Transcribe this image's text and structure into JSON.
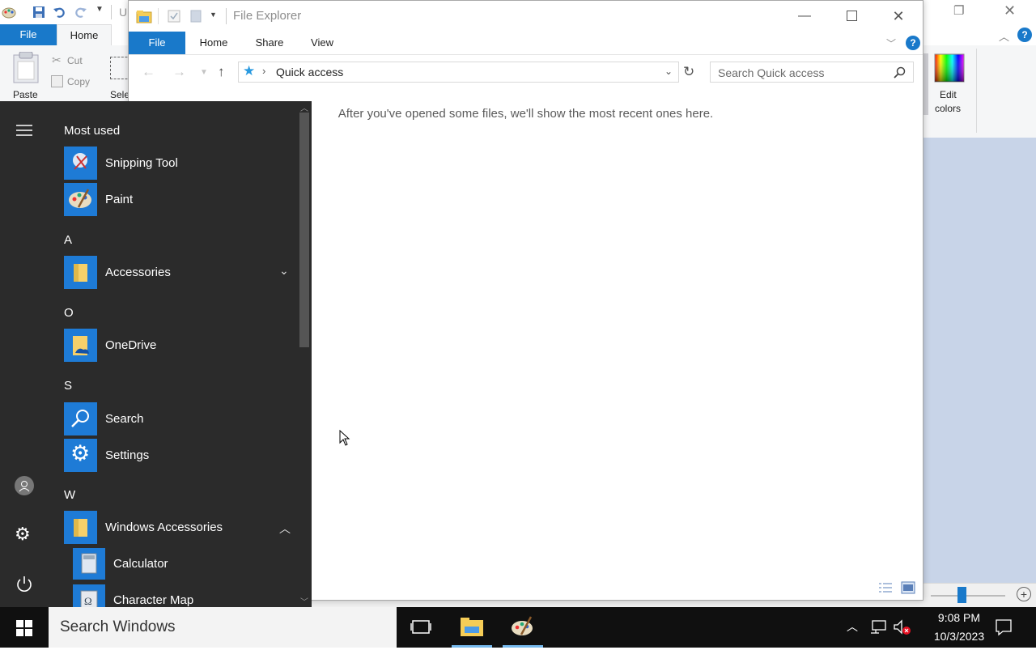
{
  "paint": {
    "title_partial": "U",
    "tab_file": "File",
    "tab_home": "Home",
    "paste": "Paste",
    "cut": "Cut",
    "copy": "Copy",
    "select_partial": "Sele",
    "edit_colors_line1": "Edit",
    "edit_colors_line2": "colors"
  },
  "explorer": {
    "title": "File Explorer",
    "tabs": [
      "File",
      "Home",
      "Share",
      "View"
    ],
    "address": "Quick access",
    "search_placeholder": "Search Quick access",
    "empty_message": "After you've opened some files, we'll show the most recent ones here."
  },
  "start_menu": {
    "most_used_header": "Most used",
    "most_used": [
      {
        "label": "Snipping Tool",
        "icon": "snipping-tool-icon"
      },
      {
        "label": "Paint",
        "icon": "paint-icon"
      }
    ],
    "sections": [
      {
        "letter": "A",
        "items": [
          {
            "label": "Accessories",
            "icon": "folder-icon",
            "expand": "down"
          }
        ]
      },
      {
        "letter": "O",
        "items": [
          {
            "label": "OneDrive",
            "icon": "onedrive-icon"
          }
        ]
      },
      {
        "letter": "S",
        "items": [
          {
            "label": "Search",
            "icon": "search-icon"
          },
          {
            "label": "Settings",
            "icon": "gear-icon"
          }
        ]
      },
      {
        "letter": "W",
        "items": [
          {
            "label": "Windows Accessories",
            "icon": "folder-icon",
            "expand": "up"
          }
        ]
      }
    ],
    "sub_items": [
      {
        "label": "Calculator",
        "icon": "calculator-icon"
      },
      {
        "label": "Character Map",
        "icon": "character-map-icon"
      }
    ]
  },
  "taskbar": {
    "search_text": "Search Windows",
    "time": "9:08 PM",
    "date": "10/3/2023"
  },
  "colors": {
    "accent": "#1979ca",
    "tile": "#1e7bd6",
    "start_bg": "#2b2b2b",
    "taskbar_bg": "#101010"
  }
}
